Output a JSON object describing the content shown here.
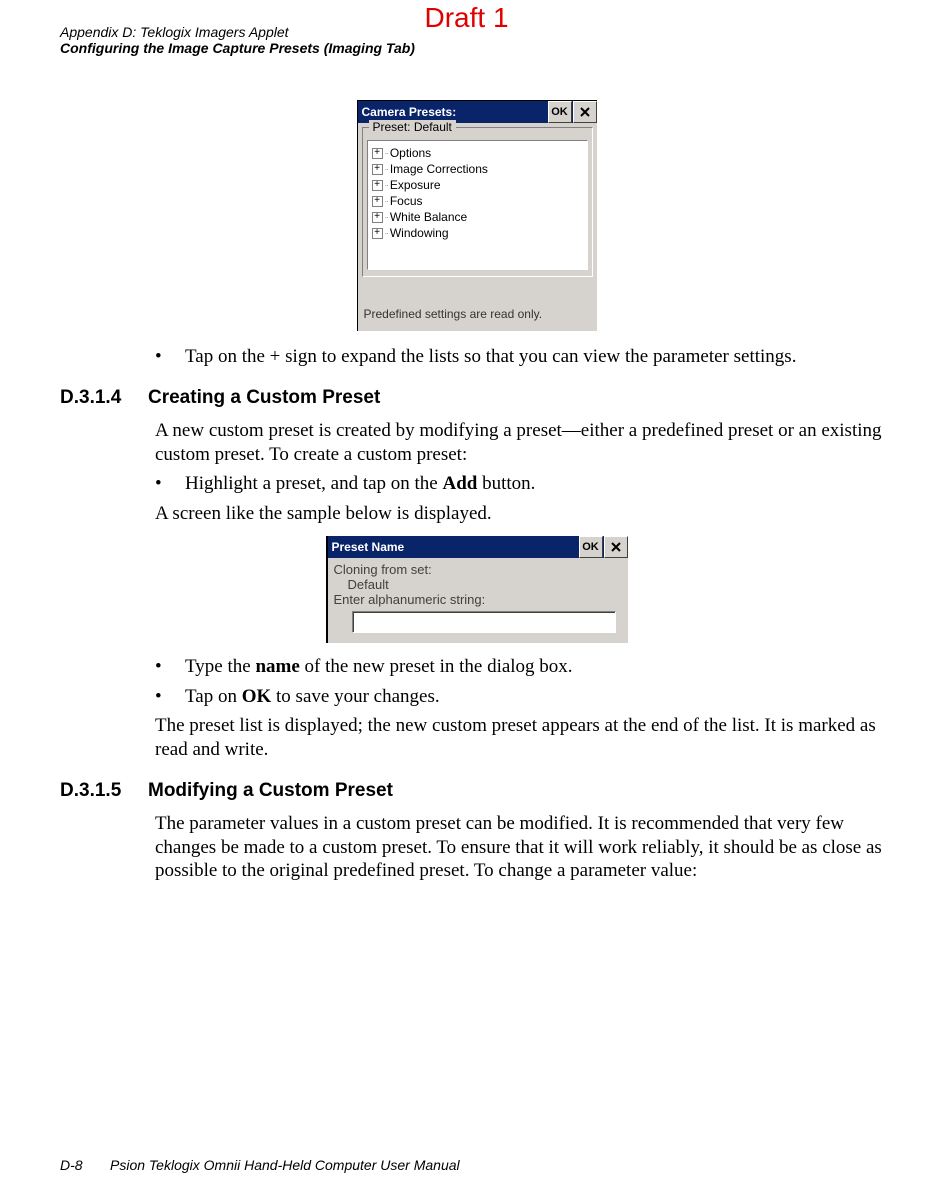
{
  "draft_label": "Draft 1",
  "header": {
    "line1": "Appendix D:  Teklogix Imagers Applet",
    "line2": "Configuring the Image Capture Presets (Imaging Tab)"
  },
  "screenshot1": {
    "title": "Camera Presets:",
    "ok_label": "OK",
    "panel_label": "Preset: Default",
    "tree_items": [
      "Options",
      "Image Corrections",
      "Exposure",
      "Focus",
      "White Balance",
      "Windowing"
    ],
    "status": "Predefined settings are read only."
  },
  "bullet1": "Tap on the + sign to expand the lists so that you can view the parameter settings.",
  "section1": {
    "num": "D.3.1.4",
    "title": "Creating a Custom Preset"
  },
  "para1": "A new custom preset is created by modifying a preset—either a predefined preset or an existing custom preset. To create a custom preset:",
  "bullet2_pre": "Highlight a preset, and tap on the ",
  "bullet2_bold": "Add",
  "bullet2_post": " button.",
  "para2": "A screen like the sample below is displayed.",
  "screenshot2": {
    "title": "Preset Name",
    "ok_label": "OK",
    "line1": "Cloning from set:",
    "line2": "Default",
    "line3": "Enter alphanumeric string:"
  },
  "bullet3_pre": "Type the ",
  "bullet3_bold": "name",
  "bullet3_post": " of the new preset in the dialog box.",
  "bullet4_pre": "Tap on ",
  "bullet4_bold": "OK",
  "bullet4_post": " to save your changes.",
  "para3": "The preset list is displayed; the new custom preset appears at the end of the list. It is marked as read and write.",
  "section2": {
    "num": "D.3.1.5",
    "title": "Modifying a Custom Preset"
  },
  "para4": "The parameter values in a custom preset can be modified. It is recommended that very few changes be made to a custom preset. To ensure that it will work reliably, it should be as close as possible to the original predefined preset. To change a parameter value:",
  "footer": {
    "page": "D-8",
    "text": "Psion Teklogix Omnii Hand-Held Computer User Manual"
  }
}
